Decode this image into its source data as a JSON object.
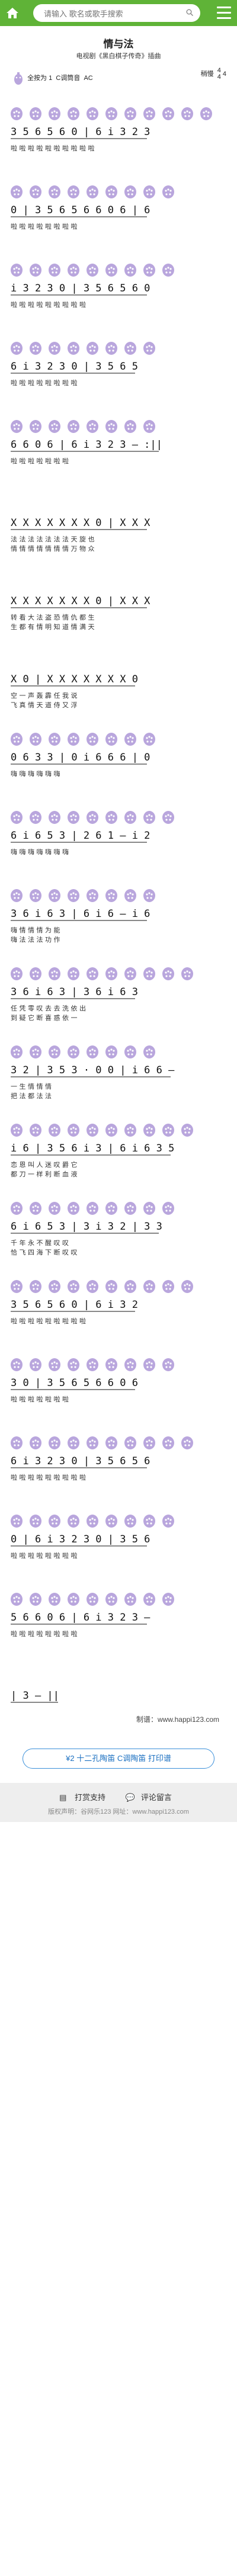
{
  "header": {
    "search_placeholder": "请输入 歌名或歌手搜索",
    "home_icon": "home-icon",
    "menu_icon": "hamburger-menu-icon",
    "search_icon": "magnifier-icon",
    "brand_color": "#5fb337"
  },
  "song": {
    "title": "情与法",
    "subtitle": "电视剧《黑白棋子传奇》插曲",
    "key_label": "全按为 1",
    "key_extra": "C调筒音",
    "tone": "AC",
    "tempo_label": "稍慢",
    "time_sig_top": "4",
    "time_sig_bottom": "4",
    "time_sig_extra": "4"
  },
  "score": {
    "hole_color": "#b9a6dd",
    "lines": [
      {
        "notes": "3 5 6 5 6 0 | 6 i 3 2 3",
        "lyrics": "啦 啦 啦 啦 啦 啦 啦 啦 啦 啦",
        "fing": [
          1,
          1,
          1,
          1,
          1,
          1,
          1,
          1,
          1,
          1,
          1
        ]
      },
      {
        "notes": "0 | 3 5 6 5 6 6 0 6 | 6",
        "lyrics": "啦 啦 啦 啦 啦 啦 啦 啦",
        "fing": [
          1,
          1,
          1,
          1,
          1,
          1,
          1,
          1,
          1
        ]
      },
      {
        "notes": "i 3 2 3 0 | 3 5 6 5 6 0",
        "lyrics": "啦 啦 啦 啦 啦 啦 啦 啦 啦",
        "fing": [
          1,
          1,
          1,
          1,
          1,
          1,
          1,
          1,
          1
        ]
      },
      {
        "notes": "6 i 3 2 3 0 | 3 5 6 5",
        "lyrics": "啦 啦 啦 啦 啦 啦 啦 啦",
        "fing": [
          1,
          1,
          1,
          1,
          1,
          1,
          1,
          1
        ]
      },
      {
        "notes": "6 6 0 6 | 6 i 3 2 3 — :||",
        "lyrics": "啦 啦 啦 啦 啦 啦 啦",
        "fing": [
          1,
          1,
          1,
          1,
          1,
          1,
          1,
          1
        ]
      },
      {
        "notes": "X X X X X X X 0 | X X X",
        "lyrics": "法 法 法 法 法 法 法 天 旋 也",
        "lyrics2": "情 情 情 情 情 情 情 万 物 众",
        "fing": []
      },
      {
        "notes": "X X X X X X X 0 | X X X",
        "lyrics": "转 看 大 法 盗 恐 情 仇 都 生",
        "lyrics2": "生 都 有 情 明 知 道 情 满 天",
        "fing": []
      },
      {
        "notes": "X 0 | X X X X X X X 0",
        "lyrics": "空 一 声 轰 霹 任 我 说",
        "lyrics2": "飞 真 情 天 道 侍 又 浮",
        "fing": []
      },
      {
        "notes": "0 6 3 3 | 0 i 6 6 6 | 0",
        "lyrics": "嗨 嗨 嗨 嗨 嗨 嗨",
        "fing": [
          1,
          1,
          1,
          1,
          1,
          1,
          1,
          1
        ]
      },
      {
        "notes": "6 i 6 5 3 | 2 6 1 — i 2",
        "lyrics": "嗨 嗨 嗨 嗨 嗨 嗨 嗨",
        "fing": [
          1,
          1,
          1,
          1,
          1,
          1,
          1,
          1,
          1
        ]
      },
      {
        "notes": "3 6 i 6 3 | 6 i 6 — i 6",
        "lyrics": "嗨 情 情 情 为 能",
        "lyrics2": "嗨 法 法 法 功 作",
        "fing": [
          1,
          1,
          1,
          1,
          1,
          1,
          1,
          1
        ]
      },
      {
        "notes": "3 6 i 6 3 | 3 6 i 6 3",
        "lyrics": "任 凭 零 叹 去 去 洗 依 出",
        "lyrics2": "到 疑 它 断 喜 惑 依 一",
        "fing": [
          1,
          1,
          1,
          1,
          1,
          1,
          1,
          1,
          1,
          1
        ]
      },
      {
        "notes": "3 2 | 3 5 3 · 0 0 | i 6 6 —",
        "lyrics": "一 生 情 情 情",
        "lyrics2": "把 法 都 法 法",
        "fing": [
          1,
          1,
          1,
          1,
          1,
          1,
          1,
          1
        ]
      },
      {
        "notes": "i 6 | 3 5 6 i 3 | 6 i 6 3 5",
        "lyrics": "恋 恩 叫 人 迷 叹 爵 它",
        "lyrics2": "都 刀 一 样 利 断 血 液",
        "fing": [
          1,
          1,
          1,
          1,
          1,
          1,
          1,
          1,
          1,
          1
        ]
      },
      {
        "notes": "6 i 6 5 3 | 3 i 3 2 | 3 3",
        "lyrics": "千 年 永 不 醒 叹 叹",
        "lyrics2": "恰 飞 四 海 下 断 叹 叹",
        "fing": [
          1,
          1,
          1,
          1,
          1,
          1,
          1,
          1,
          1
        ]
      },
      {
        "notes": "3 5 6 5 6 0 | 6 i 3 2",
        "lyrics": "啦 啦 啦 啦 啦 啦 啦 啦 啦",
        "fing": [
          1,
          1,
          1,
          1,
          1,
          1,
          1,
          1,
          1,
          1
        ]
      },
      {
        "notes": "3 0 | 3 5 6 5 6 6 0 6",
        "lyrics": "啦 啦 啦 啦 啦 啦 啦",
        "fing": [
          1,
          1,
          1,
          1,
          1,
          1,
          1,
          1,
          1
        ]
      },
      {
        "notes": "6 i 3 2 3 0 | 3 5 6 5 6",
        "lyrics": "啦 啦 啦 啦 啦 啦 啦 啦 啦",
        "fing": [
          1,
          1,
          1,
          1,
          1,
          1,
          1,
          1,
          1,
          1
        ]
      },
      {
        "notes": "0 | 6 i 3 2 3 0 | 3 5 6",
        "lyrics": "啦 啦 啦 啦 啦 啦 啦 啦",
        "fing": [
          1,
          1,
          1,
          1,
          1,
          1,
          1,
          1,
          1
        ]
      },
      {
        "notes": "5 6 6 0 6 | 6 i 3 2 3 —",
        "lyrics": "啦 啦 啦 啦 啦 啦 啦 啦",
        "fing": [
          1,
          1,
          1,
          1,
          1,
          1,
          1,
          1,
          1
        ]
      },
      {
        "notes": "| 3 — ||",
        "lyrics": "",
        "fing": []
      }
    ]
  },
  "footer": {
    "credit": "制谱：www.happi123.com",
    "action_button": "¥2 十二孔陶笛 C调陶笛 打印谱",
    "support_link": "打赏支持",
    "comment_link": "评论留言",
    "copyright": "版权声明：谷网乐123 网址：www.happi123.com"
  }
}
